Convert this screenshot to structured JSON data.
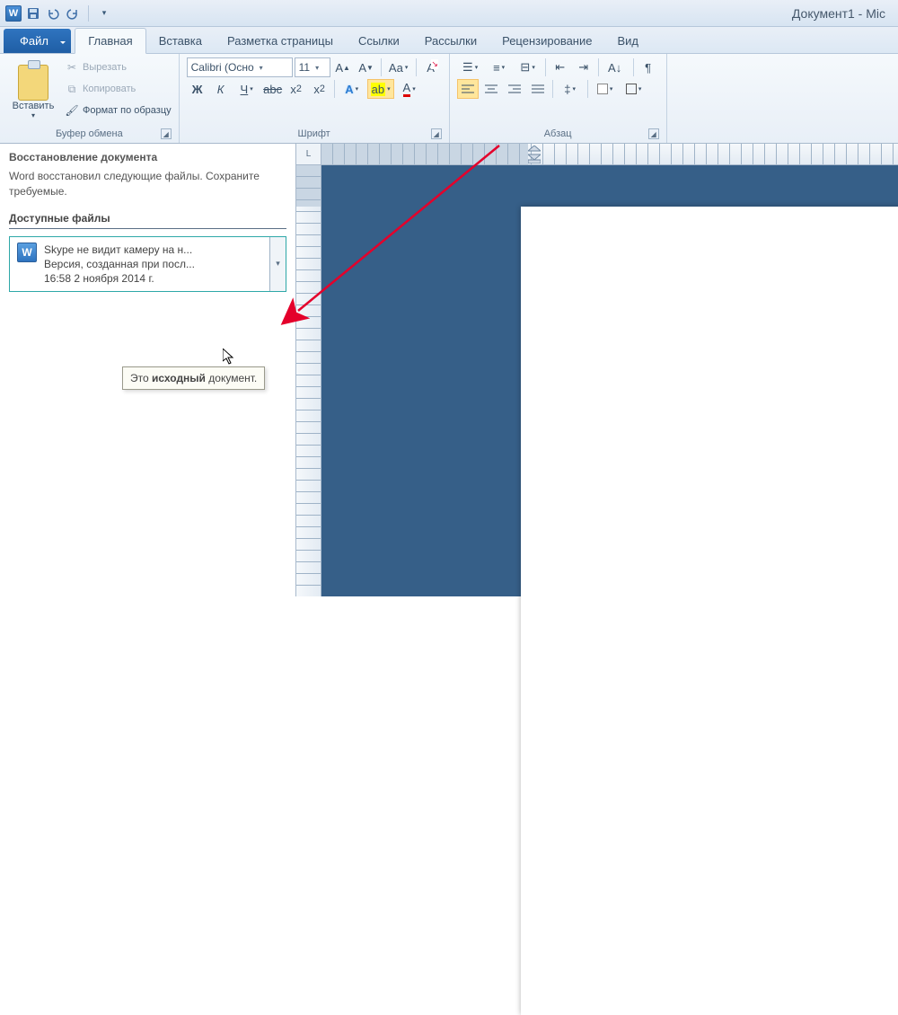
{
  "app_title": "Документ1 - Mic",
  "tabs": {
    "file": "Файл",
    "home": "Главная",
    "insert": "Вставка",
    "layout": "Разметка страницы",
    "references": "Ссылки",
    "mailings": "Рассылки",
    "review": "Рецензирование",
    "view": "Вид"
  },
  "clipboard": {
    "paste": "Вставить",
    "cut": "Вырезать",
    "copy": "Копировать",
    "format_painter": "Формат по образцу",
    "group_label": "Буфер обмена"
  },
  "font": {
    "name": "Calibri (Осно",
    "size": "11",
    "group_label": "Шрифт"
  },
  "paragraph": {
    "group_label": "Абзац"
  },
  "recovery": {
    "title": "Восстановление документа",
    "desc": "Word восстановил следующие файлы. Сохраните требуемые.",
    "available": "Доступные файлы",
    "item": {
      "line1": "Skype не видит камеру на н...",
      "line2": "Версия, созданная при посл...",
      "line3": "16:58 2 ноября 2014 г."
    },
    "tooltip_prefix": "Это ",
    "tooltip_bold": "исходный",
    "tooltip_suffix": " документ."
  }
}
